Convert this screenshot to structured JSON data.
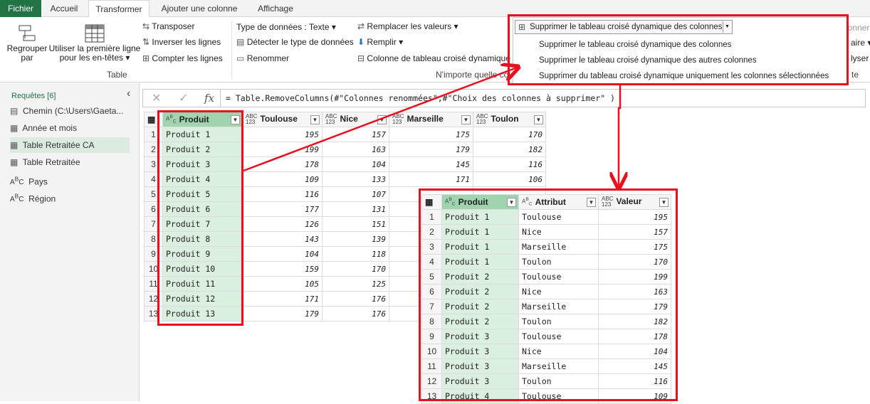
{
  "tabs": [
    "Fichier",
    "Accueil",
    "Transformer",
    "Ajouter une colonne",
    "Affichage"
  ],
  "ribbon": {
    "group_by": [
      "Regrouper",
      "par"
    ],
    "first_row": [
      "Utiliser la première ligne",
      "pour les en-têtes ▾"
    ],
    "group_label": "Table",
    "transpose": "Transposer",
    "reverse": "Inverser les lignes",
    "count": "Compter les lignes",
    "data_type": "Type de données : Texte ▾",
    "detect": "Détecter le type de données",
    "rename": "Renommer",
    "replace": "Remplacer les valeurs ▾",
    "fill": "Remplir ▾",
    "pivot": "Colonne de tableau croisé dynamique",
    "any_col": "N'importe quelle colo",
    "merge": "Fusionner",
    "right_frag1": "aire ▾",
    "right_frag2": "lyser ▾",
    "right_frag3": "te",
    "unpivot_dropdown": "Supprimer le tableau croisé dynamique des colonnes"
  },
  "menu": [
    "Supprimer le tableau croisé dynamique des colonnes",
    "Supprimer le tableau croisé dynamique des autres colonnes",
    "Supprimer du tableau croisé dynamique uniquement les colonnes sélectionnées"
  ],
  "queries": {
    "title": "Requêtes [6]",
    "items": [
      "Chemin (C:\\Users\\Gaeta...",
      "Année et mois",
      "Table Retraitée CA",
      "Table Retraitée",
      "Pays",
      "Région"
    ]
  },
  "formula": {
    "fx": "fx",
    "text": "= Table.RemoveColumns(#\"Colonnes renommées\",#\"Choix des colonnes à supprimer\" )"
  },
  "grid1": {
    "headers": [
      "Produit",
      "Toulouse",
      "Nice",
      "Marseille",
      "Toulon"
    ],
    "rows": [
      [
        "Produit 1",
        195,
        157,
        175,
        170
      ],
      [
        "Produit 2",
        199,
        163,
        179,
        182
      ],
      [
        "Produit 3",
        178,
        104,
        145,
        116
      ],
      [
        "Produit 4",
        109,
        133,
        171,
        106
      ],
      [
        "Produit 5",
        116,
        107,
        "",
        ""
      ],
      [
        "Produit 6",
        177,
        131,
        "",
        ""
      ],
      [
        "Produit 7",
        126,
        151,
        "",
        ""
      ],
      [
        "Produit 8",
        143,
        139,
        "",
        ""
      ],
      [
        "Produit 9",
        104,
        118,
        "",
        ""
      ],
      [
        "Produit 10",
        159,
        170,
        "",
        ""
      ],
      [
        "Produit 11",
        105,
        125,
        "",
        ""
      ],
      [
        "Produit 12",
        171,
        176,
        "",
        ""
      ],
      [
        "Produit 13",
        179,
        176,
        "",
        ""
      ]
    ]
  },
  "grid2": {
    "headers": [
      "Produit",
      "Attribut",
      "Valeur"
    ],
    "rows": [
      [
        "Produit 1",
        "Toulouse",
        195
      ],
      [
        "Produit 1",
        "Nice",
        157
      ],
      [
        "Produit 1",
        "Marseille",
        175
      ],
      [
        "Produit 1",
        "Toulon",
        170
      ],
      [
        "Produit 2",
        "Toulouse",
        199
      ],
      [
        "Produit 2",
        "Nice",
        163
      ],
      [
        "Produit 2",
        "Marseille",
        179
      ],
      [
        "Produit 2",
        "Toulon",
        182
      ],
      [
        "Produit 3",
        "Toulouse",
        178
      ],
      [
        "Produit 3",
        "Nice",
        104
      ],
      [
        "Produit 3",
        "Marseille",
        145
      ],
      [
        "Produit 3",
        "Toulon",
        116
      ],
      [
        "Produit 4",
        "Toulouse",
        109
      ]
    ]
  },
  "colors": {
    "accent": "#217346",
    "highlight": "#e8101f",
    "selected": "#dbefe1"
  }
}
